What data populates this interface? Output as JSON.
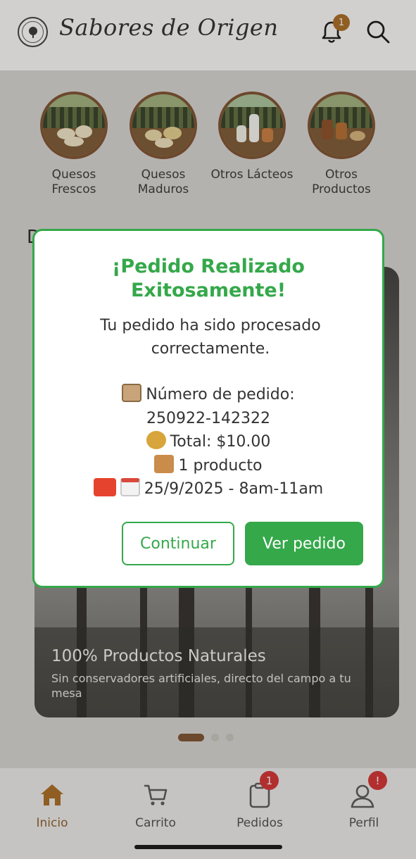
{
  "header": {
    "brand": "Sabores de Origen",
    "notification_count": "1"
  },
  "categories": [
    {
      "label": "Quesos Frescos"
    },
    {
      "label": "Quesos Maduros"
    },
    {
      "label": "Otros Lácteos"
    },
    {
      "label": "Otros Productos"
    }
  ],
  "banner": {
    "title": "100% Productos Naturales",
    "subtitle": "Sin conservadores artificiales, directo del campo a tu mesa"
  },
  "modal": {
    "title": "¡Pedido Realizado Exitosamente!",
    "message": "Tu pedido ha sido procesado correctamente.",
    "order_label": "Número de pedido:",
    "order_number": "250922-142322",
    "total": "Total: $10.00",
    "items": "1 producto",
    "delivery": "25/9/2025 - 8am-11am",
    "continue_label": "Continuar",
    "view_label": "Ver pedido"
  },
  "nav": {
    "items": [
      {
        "label": "Inicio",
        "icon": "home-icon"
      },
      {
        "label": "Carrito",
        "icon": "cart-icon"
      },
      {
        "label": "Pedidos",
        "icon": "orders-icon",
        "badge": "1"
      },
      {
        "label": "Perfil",
        "icon": "profile-icon",
        "badge": "!"
      }
    ]
  },
  "colors": {
    "accent_green": "#35a84a",
    "brand_brown": "#7a4d2b",
    "badge_red": "#d32f2f"
  }
}
